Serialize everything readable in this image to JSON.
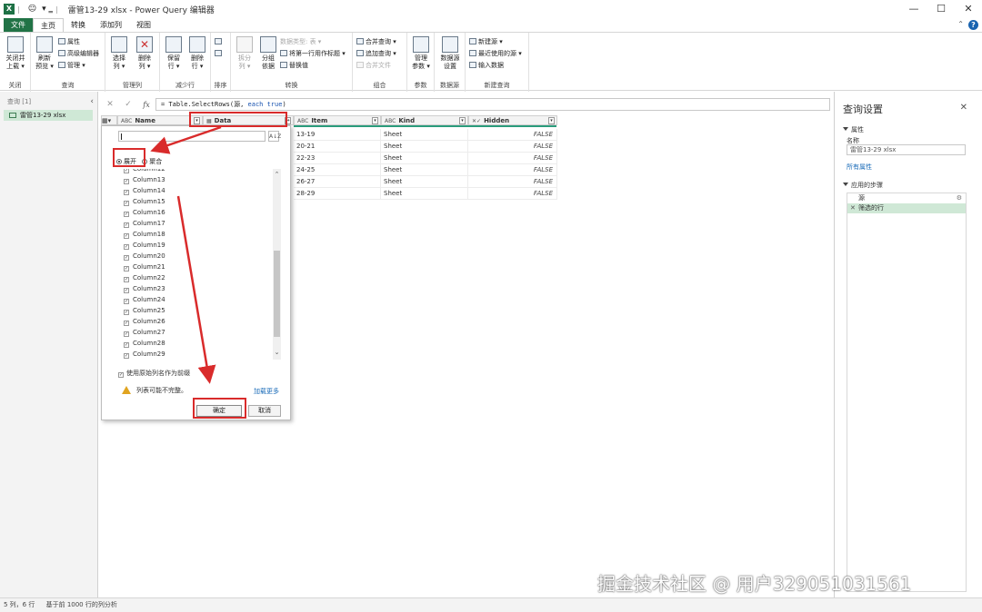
{
  "titlebar": {
    "emoji": "😐",
    "title": "雷管13-29 xlsx - Power Query 编辑器",
    "min": "—",
    "max": "☐",
    "close": "✕"
  },
  "menu": {
    "tabs": [
      "文件",
      "主页",
      "转换",
      "添加列",
      "视图"
    ],
    "help": "?"
  },
  "ribbon": {
    "close_group": {
      "close_upload": "关闭并\n上载 ▾",
      "label": "关闭"
    },
    "query_group": {
      "refresh": "刷新\n预览 ▾",
      "properties": "属性",
      "advanced_editor": "高级编辑器",
      "manage": "管理 ▾",
      "label": "查询"
    },
    "manage_cols_group": {
      "choose_cols": "选择\n列 ▾",
      "remove_cols": "删除\n列 ▾",
      "label": "管理列"
    },
    "reduce_rows_group": {
      "keep_rows": "保留\n行 ▾",
      "remove_rows": "删除\n行 ▾",
      "label": "减少行"
    },
    "sort_group": {
      "label": "排序"
    },
    "transform_group": {
      "split_col": "拆分\n列 ▾",
      "group_by": "分组\n依据",
      "data_type": "数据类型: 表 ▾",
      "use_first_row": "将第一行用作标题 ▾",
      "replace_values": "替换值",
      "label": "转换"
    },
    "combine_group": {
      "merge_queries": "合并查询 ▾",
      "append_queries": "追加查询 ▾",
      "combine_files": "合并文件",
      "label": "组合"
    },
    "params_group": {
      "manage_params": "管理\n参数 ▾",
      "label": "参数"
    },
    "datasource_group": {
      "settings": "数据源\n设置",
      "label": "数据源"
    },
    "newquery_group": {
      "new_source": "新建源 ▾",
      "recent_sources": "最近使用的源 ▾",
      "enter_data": "输入数据",
      "label": "新建查询"
    }
  },
  "querypane": {
    "header": "查询 [1]",
    "collapse": "‹",
    "item": "雷管13-29 xlsx"
  },
  "formulabar": {
    "cancel": "✕",
    "commit": "✓",
    "fx": "fx",
    "formula_pre": "= Table.SelectRows(源, ",
    "formula_kw": "each true",
    "formula_post": ")"
  },
  "grid": {
    "columns": [
      {
        "type_icon": "ABC",
        "name": "Name"
      },
      {
        "type_icon": "▦",
        "name": "Data"
      },
      {
        "type_icon": "ABC",
        "name": "Item"
      },
      {
        "type_icon": "ABC",
        "name": "Kind"
      },
      {
        "type_icon": "✕✓",
        "name": "Hidden"
      }
    ],
    "rows": [
      {
        "item": "13-19",
        "kind": "Sheet",
        "hidden": "FALSE"
      },
      {
        "item": "20-21",
        "kind": "Sheet",
        "hidden": "FALSE"
      },
      {
        "item": "22-23",
        "kind": "Sheet",
        "hidden": "FALSE"
      },
      {
        "item": "24-25",
        "kind": "Sheet",
        "hidden": "FALSE"
      },
      {
        "item": "26-27",
        "kind": "Sheet",
        "hidden": "FALSE"
      },
      {
        "item": "28-29",
        "kind": "Sheet",
        "hidden": "FALSE"
      }
    ]
  },
  "dropdown": {
    "sort_icon": "A↓Z",
    "expand": "展开",
    "aggregate": "聚合",
    "columns": [
      {
        "name": "Column12",
        "checked": true
      },
      {
        "name": "Column13",
        "checked": true
      },
      {
        "name": "Column14",
        "checked": true
      },
      {
        "name": "Column15",
        "checked": true
      },
      {
        "name": "Column16",
        "checked": true
      },
      {
        "name": "Column17",
        "checked": true
      },
      {
        "name": "Column18",
        "checked": true
      },
      {
        "name": "Column19",
        "checked": true
      },
      {
        "name": "Column20",
        "checked": true
      },
      {
        "name": "Column21",
        "checked": true
      },
      {
        "name": "Column22",
        "checked": true
      },
      {
        "name": "Column23",
        "checked": true
      },
      {
        "name": "Column24",
        "checked": true
      },
      {
        "name": "Column25",
        "checked": true
      },
      {
        "name": "Column26",
        "checked": true
      },
      {
        "name": "Column27",
        "checked": true
      },
      {
        "name": "Column28",
        "checked": true
      },
      {
        "name": "Column29",
        "checked": true
      }
    ],
    "use_prefix": "使用原始列名作为前缀",
    "warning": "列表可能不完整。",
    "load_more": "加载更多",
    "ok": "确定",
    "cancel": "取消"
  },
  "settings": {
    "title": "查询设置",
    "close": "✕",
    "properties": "属性",
    "name_label": "名称",
    "name_value": "雷管13-29 xlsx",
    "all_properties": "所有属性",
    "applied_steps": "应用的步骤",
    "steps": [
      {
        "name": "源",
        "active": false
      },
      {
        "name": "筛选的行",
        "active": true
      }
    ]
  },
  "statusbar": {
    "counts": "5 列，6 行",
    "profile": "基于前 1000 行的列分析"
  },
  "watermark": "掘金技术社区 @ 用户329051031561",
  "colors": {
    "excel_green": "#217346",
    "selection_green": "#cfe8d6",
    "annotation_red": "#d92b2b",
    "link_blue": "#1a6bb8"
  }
}
